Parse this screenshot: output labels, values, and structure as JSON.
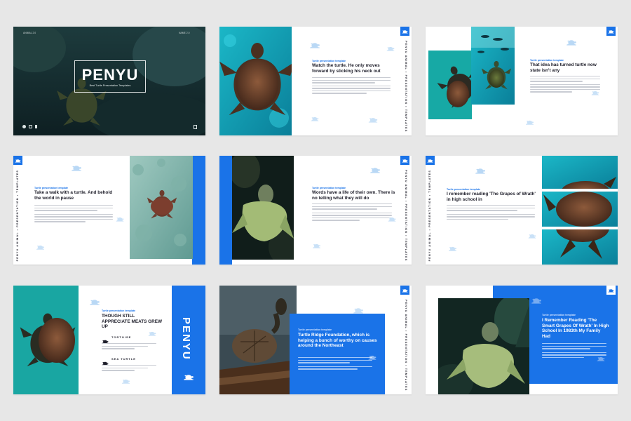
{
  "colors": {
    "accent": "#1a73e8",
    "teal": "#17a9a5",
    "dark": "#1e1e2a",
    "background": "#e7e7e7"
  },
  "side_label": "PENYU ANIMAL • PRESENTATION • TEMPLATES",
  "slide1": {
    "small_left": "ANIMAL 2.0",
    "small_right": "NAME 2.0",
    "title": "PENYU",
    "subtitle": "Best Turtle Presentation Templates",
    "social": [
      "twitter-icon",
      "instagram-icon",
      "facebook-icon"
    ]
  },
  "slide2": {
    "tag": "Turtle presentation template",
    "heading": "Watch the turtle. He only moves forward by sticking his neck out"
  },
  "slide3": {
    "tag": "Turtle presentation template",
    "heading": "That idea has turned turtle now state isn't any"
  },
  "slide4": {
    "tag": "Turtle presentation template",
    "heading": "Take a walk with a turtle. And behold the world in pause"
  },
  "slide5": {
    "tag": "Turtle presentation template",
    "heading": "Words have a life of their own. There is no telling what they will do"
  },
  "slide6": {
    "tag": "Turtle presentation template",
    "heading": "I remember reading 'The Grapes of Wrath' in high school in"
  },
  "slide7": {
    "tag": "Turtle presentation template",
    "heading": "THOUGH STILL APPRECIATE MEATS GREW UP",
    "items": [
      "TORTOISE",
      "SEA TURTLE"
    ],
    "title_vertical": "PENYU"
  },
  "slide8": {
    "tag": "Turtle presentation template",
    "heading": "Turtle Ridge Foundation, which is helping a bunch of worthy on causes around the Northeast"
  },
  "slide9": {
    "tag": "Turtle presentation template",
    "heading": "I Remember Reading 'The Smart Grapes Of Wrath' In High School In 1983th My Family Had"
  }
}
